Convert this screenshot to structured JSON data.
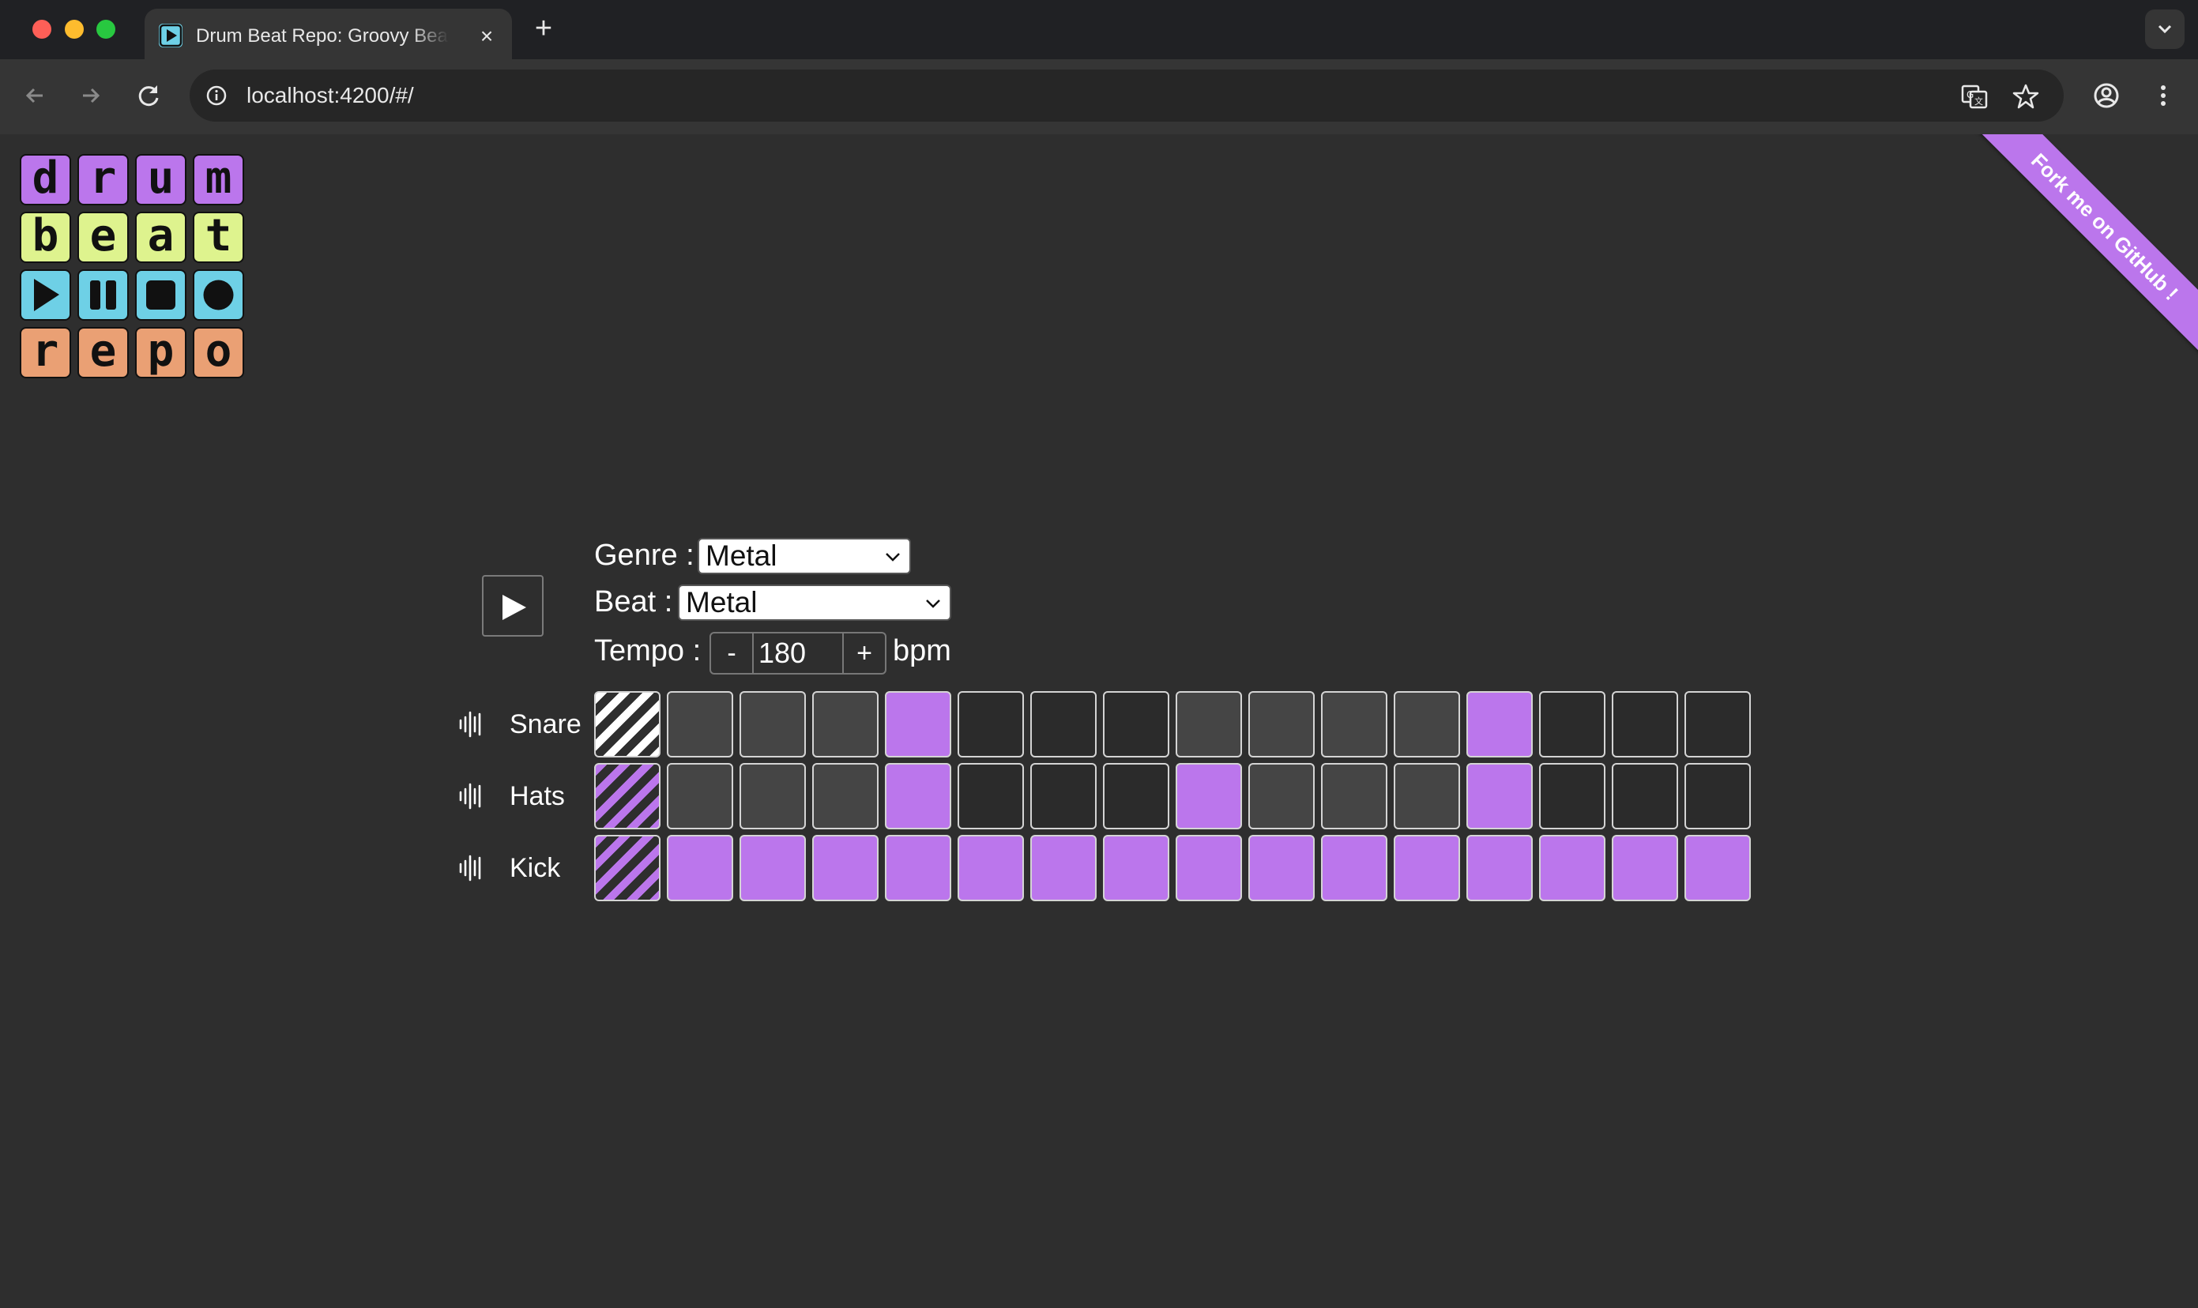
{
  "browser": {
    "tab_title": "Drum Beat Repo: Groovy Beats",
    "tab_favicon": "play-square-icon",
    "url": "localhost:4200/#/"
  },
  "logo": {
    "rows": [
      {
        "tiles": [
          "d",
          "r",
          "u",
          "m"
        ],
        "color": "#bb76ec"
      },
      {
        "tiles": [
          "b",
          "e",
          "a",
          "t"
        ],
        "color": "#def38e"
      },
      {
        "tiles": [
          "play-icon",
          "pause-icon",
          "stop-icon",
          "record-icon"
        ],
        "color": "#6ed0e6"
      },
      {
        "tiles": [
          "r",
          "e",
          "p",
          "o"
        ],
        "color": "#eaa074"
      }
    ]
  },
  "ribbon": {
    "text": "Fork me on GitHub !"
  },
  "controls": {
    "genre_label": "Genre :",
    "genre_value": "Metal",
    "beat_label": "Beat :",
    "beat_value": "Metal",
    "tempo_label": "Tempo :",
    "tempo_minus": "-",
    "tempo_value": "180",
    "tempo_plus": "+",
    "tempo_unit": "bpm"
  },
  "sequencer": {
    "current_step": 0,
    "tracks": [
      {
        "name": "Snare",
        "steps": [
          0,
          0,
          0,
          0,
          1,
          0,
          0,
          0,
          0,
          0,
          0,
          0,
          1,
          0,
          0,
          0
        ]
      },
      {
        "name": "Hats",
        "steps": [
          1,
          0,
          0,
          0,
          1,
          0,
          0,
          0,
          1,
          0,
          0,
          0,
          1,
          0,
          0,
          0
        ]
      },
      {
        "name": "Kick",
        "steps": [
          1,
          1,
          1,
          1,
          1,
          1,
          1,
          1,
          1,
          1,
          1,
          1,
          1,
          1,
          1,
          1
        ]
      }
    ]
  },
  "colors": {
    "accent": "#bb76ec",
    "background": "#2e2e2e",
    "beat_group_dim": "#454545",
    "beat_group_dark": "#2b2b2b"
  }
}
